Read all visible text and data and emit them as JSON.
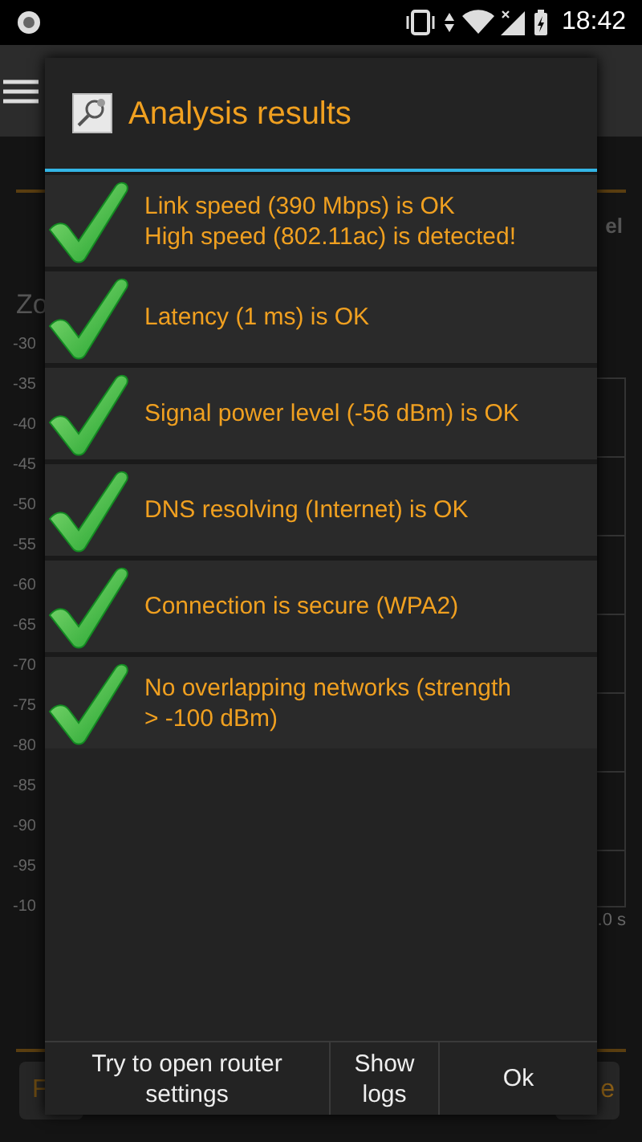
{
  "status_bar": {
    "time": "18:42"
  },
  "background": {
    "section_label": "Zo",
    "tab_fragment": "el",
    "y_axis_labels": [
      "-30",
      "-35",
      "-40",
      "-45",
      "-50",
      "-55",
      "-60",
      "-65",
      "-70",
      "-75",
      "-80",
      "-85",
      "-90",
      "-95",
      "-10"
    ],
    "x_axis_fragment": ".0 s",
    "left_button_fragment": "F",
    "right_button_fragment": "e"
  },
  "dialog": {
    "title": "Analysis results",
    "results": [
      {
        "passed": true,
        "lines": [
          "Link speed (390 Mbps) is OK",
          "High speed (802.11ac) is detected!"
        ]
      },
      {
        "passed": true,
        "lines": [
          "Latency (1 ms) is OK"
        ]
      },
      {
        "passed": true,
        "lines": [
          "Signal power level (-56 dBm) is OK"
        ]
      },
      {
        "passed": true,
        "lines": [
          "DNS resolving (Internet) is OK"
        ]
      },
      {
        "passed": true,
        "lines": [
          "Connection is secure (WPA2)"
        ]
      },
      {
        "passed": true,
        "lines": [
          "No overlapping networks (strength > -100 dBm)"
        ]
      }
    ],
    "buttons": [
      "Try to open router settings",
      "Show logs",
      "Ok"
    ]
  }
}
